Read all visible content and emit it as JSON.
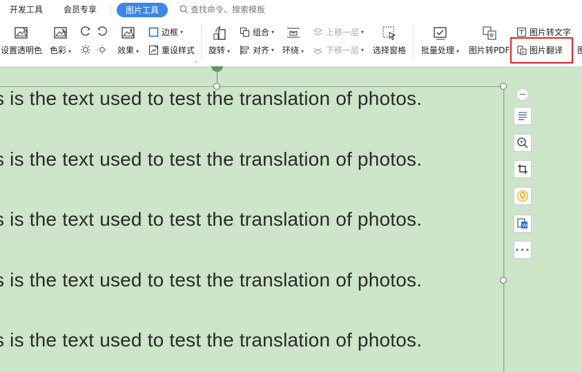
{
  "tabs": [
    {
      "label": "开发工具"
    },
    {
      "label": "会员专享"
    },
    {
      "label": "图片工具",
      "active": true
    }
  ],
  "search": {
    "placeholder": "查找命令、搜索模板"
  },
  "ribbon": {
    "set_transparent": "设置透明色",
    "color": "色彩",
    "effects": "效果",
    "border": "边框",
    "reset_style": "重设样式",
    "rotate": "旋转",
    "group": "组合",
    "align": "对齐",
    "wrap": "环绕",
    "bring_forward": "上移一层",
    "send_backward": "下移一层",
    "selection_pane": "选择窗格",
    "batch_process": "批量处理",
    "to_pdf": "图片转PDF",
    "to_text": "图片转文字",
    "translate": "图片翻译"
  },
  "document": {
    "lines": [
      "s is the text used to test the translation of photos.",
      "s is the text used to test the translation of photos.",
      "s is the text used to test the translation of photos.",
      "s is the text used to test the translation of photos.",
      "s is the text used to test the translation of photos."
    ]
  },
  "side_tools": [
    "minus-icon",
    "ocr-text-icon",
    "zoom-icon",
    "crop-icon",
    "lightbulb-icon",
    "word-convert-icon",
    "more-icon"
  ],
  "colors": {
    "accent": "#3b86e8",
    "highlight": "#e02020",
    "canvas_bg": "#cde5c9"
  }
}
